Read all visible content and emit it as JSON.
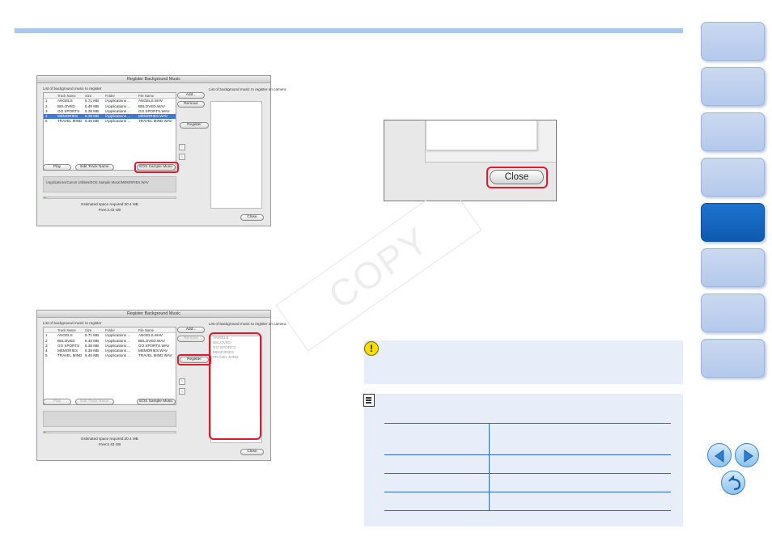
{
  "dialog1": {
    "title": "Register Background Music",
    "list_label": "List of background music to register",
    "columns": [
      "Track Name",
      "Size",
      "Folder",
      "File Name"
    ],
    "rows": [
      {
        "n": "1",
        "track": "ANGELS",
        "size": "5.71 MB",
        "folder": "/Applications ...",
        "file": "ANGELS.WAV"
      },
      {
        "n": "2",
        "track": "BELOVED",
        "size": "6.48 MB",
        "folder": "/Applications ...",
        "file": "BELOVED.WAV"
      },
      {
        "n": "3",
        "track": "GO SPORTS",
        "size": "5.38 MB",
        "folder": "/Applications ...",
        "file": "GO SPORTS.WAV"
      },
      {
        "n": "4",
        "track": "MEMORIES",
        "size": "6.39 MB",
        "folder": "/Applications ...",
        "file": "MEMORIES.WAV"
      },
      {
        "n": "5",
        "track": "TRAVEL MIND",
        "size": "6.46 MB",
        "folder": "/Applications ...",
        "file": "TRAVEL MIND.WAV"
      }
    ],
    "selected_row": "4",
    "add_label": "Add...",
    "remove_label": "Remove",
    "register_label": "Register",
    "play_label": "Play",
    "edit_label": "Edit Track Name",
    "eos_label": "EOS Sample Music",
    "path_text": "/Applications/Canon Utilities/EOS Sample Music/MEMORIES.WAV",
    "camera_label": "List of background music to register on camera",
    "estimated": "Estimated space required:30.4 MB",
    "free": "Free:3.43 GB",
    "close_label": "Close",
    "camera_items": []
  },
  "dialog2": {
    "title": "Register Background Music",
    "list_label": "List of background music to register",
    "columns": [
      "Track Name",
      "Size",
      "Folder",
      "File Name"
    ],
    "rows": [
      {
        "n": "1",
        "track": "ANGELS",
        "size": "5.71 MB",
        "folder": "/Applications ...",
        "file": "ANGELS.WAV"
      },
      {
        "n": "2",
        "track": "BELOVED",
        "size": "6.48 MB",
        "folder": "/Applications ...",
        "file": "BELOVED.WAV"
      },
      {
        "n": "3",
        "track": "GO SPORTS",
        "size": "5.38 MB",
        "folder": "/Applications ...",
        "file": "GO SPORTS.WAV"
      },
      {
        "n": "4",
        "track": "MEMORIES",
        "size": "6.39 MB",
        "folder": "/Applications ...",
        "file": "MEMORIES.WAV"
      },
      {
        "n": "5",
        "track": "TRAVEL MIND",
        "size": "6.46 MB",
        "folder": "/Applications ...",
        "file": "TRAVEL MIND.WAV"
      }
    ],
    "selected_row": "",
    "add_label": "Add...",
    "remove_label": "Remove",
    "register_label": "Register",
    "play_label": "Play",
    "edit_label": "Edit Track Name",
    "eos_label": "EOS Sample Music",
    "path_text": "",
    "camera_label": "List of background music to register on camera",
    "estimated": "Estimated space required:30.4 MB",
    "free": "Free:3.43 GB",
    "close_label": "Close",
    "camera_items": [
      "ANGELS",
      "BELOVED",
      "GO SPORTS",
      "MEMORIES",
      "TRAVEL MIND"
    ]
  },
  "zoom": {
    "close_label": "Close"
  },
  "watermark": "COPY",
  "caution": {
    "icon": "!",
    "icon_name": "caution-icon"
  },
  "memo": {
    "icon_name": "memo-icon",
    "table_rows": 4
  },
  "sidebar": {
    "tab_count": 8,
    "active_index": 4
  },
  "nav": {
    "prev_icon": "left-arrow-icon",
    "next_icon": "right-arrow-icon",
    "return_icon": "return-icon"
  },
  "colors": {
    "accent_bar": "#a9c8ef",
    "highlight": "#e0192c",
    "active_tab": "#0b5ab0",
    "tab": "#b5c9ec",
    "note_bg": "#e7eefa",
    "table_rule": "#2a66c4"
  }
}
